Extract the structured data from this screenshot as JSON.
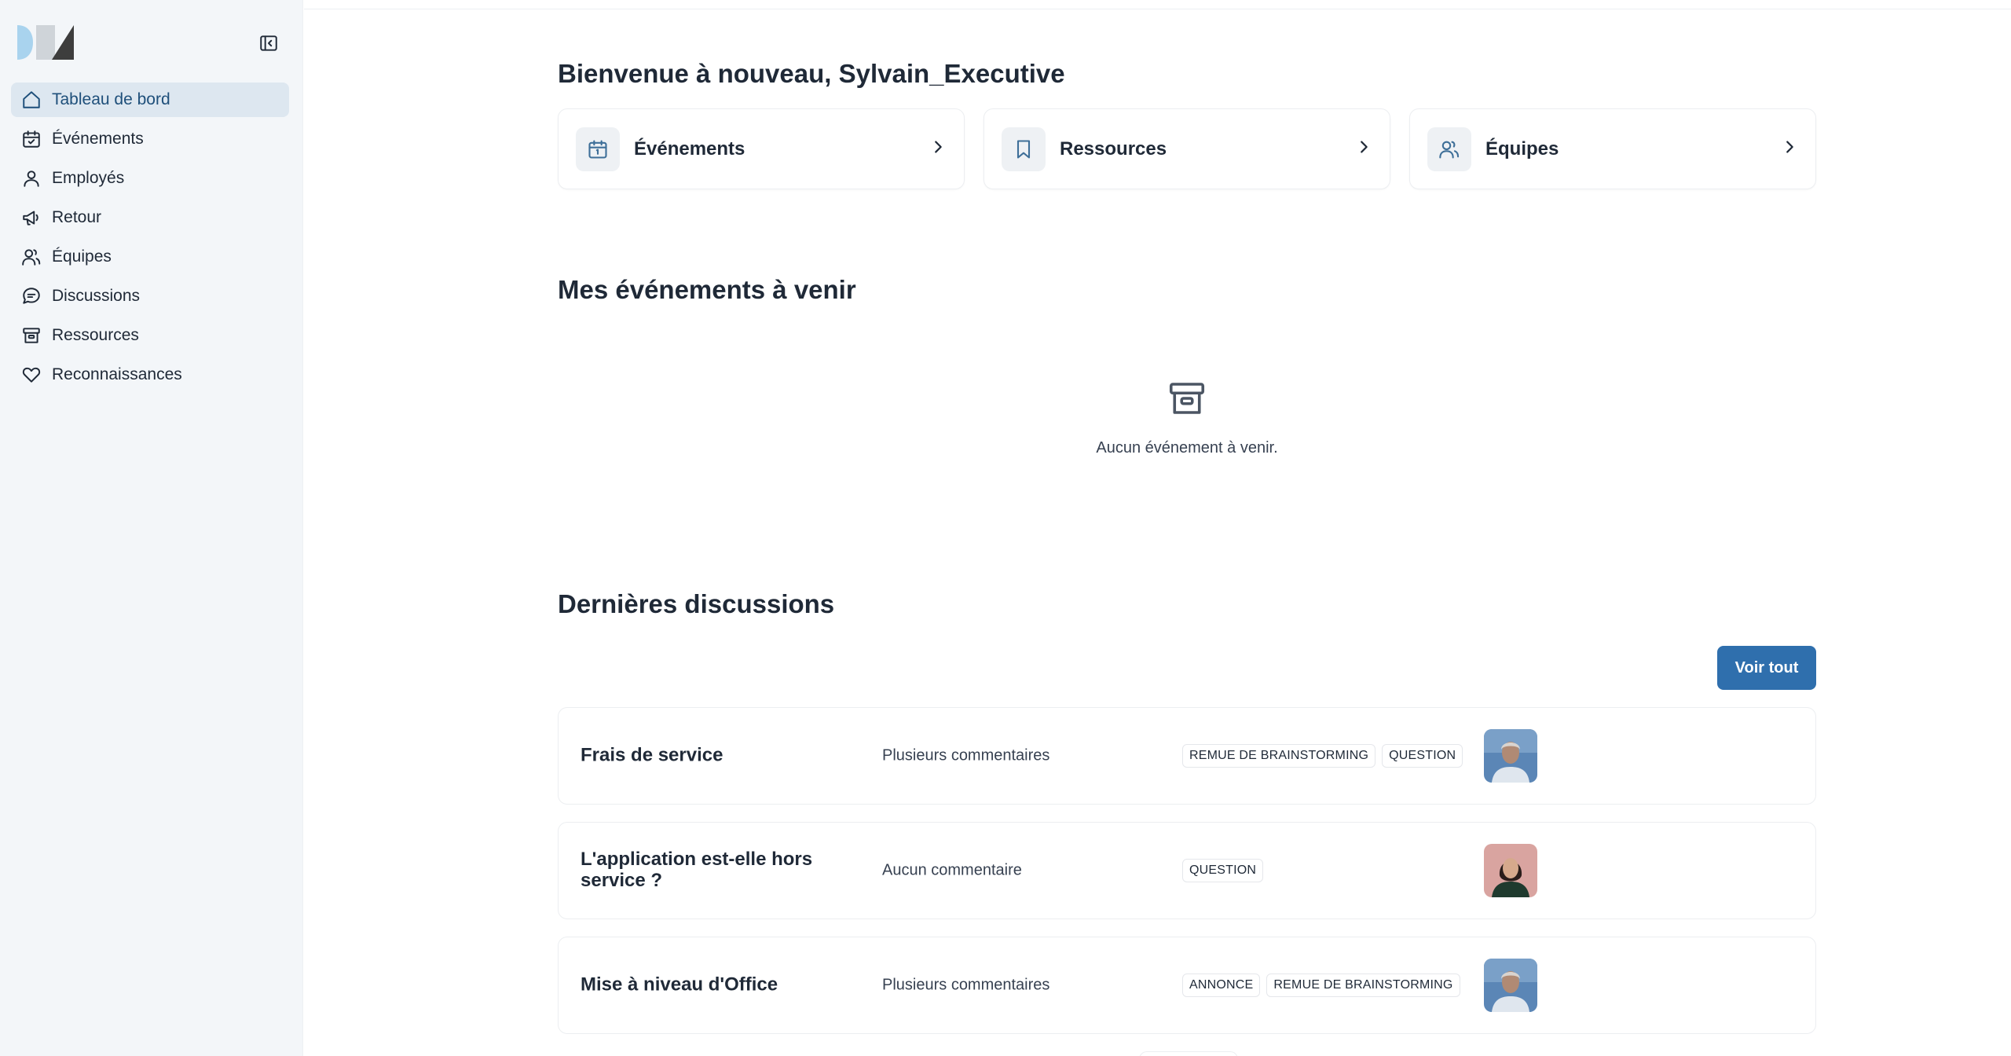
{
  "sidebar": {
    "items": [
      {
        "label": "Tableau de bord",
        "icon": "home-icon",
        "active": true
      },
      {
        "label": "Événements",
        "icon": "calendar-check-icon"
      },
      {
        "label": "Employés",
        "icon": "user-icon"
      },
      {
        "label": "Retour",
        "icon": "megaphone-icon"
      },
      {
        "label": "Équipes",
        "icon": "users-icon"
      },
      {
        "label": "Discussions",
        "icon": "chat-bubble-icon"
      },
      {
        "label": "Ressources",
        "icon": "archive-icon"
      },
      {
        "label": "Reconnaissances",
        "icon": "heart-icon"
      }
    ]
  },
  "main": {
    "welcome": "Bienvenue à nouveau, Sylvain_Executive",
    "cards": [
      {
        "label": "Événements",
        "icon": "calendar-icon"
      },
      {
        "label": "Ressources",
        "icon": "bookmark-icon"
      },
      {
        "label": "Équipes",
        "icon": "users-icon"
      }
    ],
    "upcoming_title": "Mes événements à venir",
    "upcoming_empty": "Aucun événement à venir.",
    "discussions_title": "Dernières discussions",
    "view_all": "Voir tout",
    "discussions": [
      {
        "title": "Frais de service",
        "comments": "Plusieurs commentaires",
        "tags": [
          "REMUE DE BRAINSTORMING",
          "QUESTION"
        ]
      },
      {
        "title": "L'application est-elle hors service ?",
        "comments": "Aucun commentaire",
        "tags": [
          "QUESTION"
        ]
      },
      {
        "title": "Mise à niveau d'Office",
        "comments": "Plusieurs commentaires",
        "tags": [
          "ANNONCE",
          "REMUE DE BRAINSTORMING"
        ]
      }
    ]
  },
  "colors": {
    "primary": "#2f6fad",
    "sidebar_bg": "#f3f6f9",
    "active_bg": "#dde7f0",
    "active_text": "#1e4f7a"
  }
}
